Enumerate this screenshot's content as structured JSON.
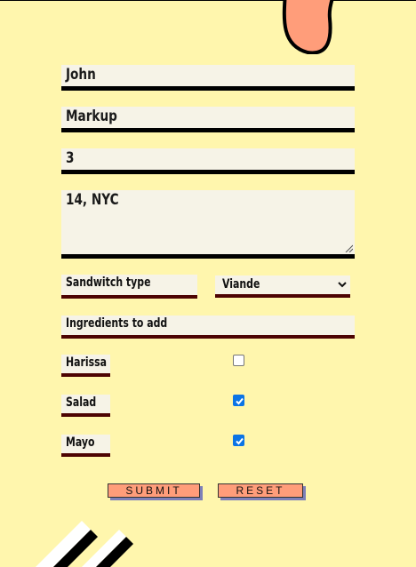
{
  "form": {
    "first_name": "John",
    "last_name": "Markup",
    "number": "3",
    "address": "14, NYC",
    "sandwich_type_label": "Sandwitch type",
    "sandwich_type_value": "Viande",
    "ingredients_label": "Ingredients to add",
    "ingredients": [
      {
        "label": "Harissa",
        "checked": false
      },
      {
        "label": "Salad",
        "checked": true
      },
      {
        "label": "Mayo",
        "checked": true
      }
    ],
    "submit_label": "SUBMIT",
    "reset_label": "RESET"
  },
  "colors": {
    "background": "#fff6ad",
    "field": "#f6f3e7",
    "accent_border": "#4d0303",
    "button": "#ff9d7a",
    "button_shadow": "#7d7fb8",
    "checkbox": "#0b74e5",
    "blob": "#ff9d7a"
  }
}
